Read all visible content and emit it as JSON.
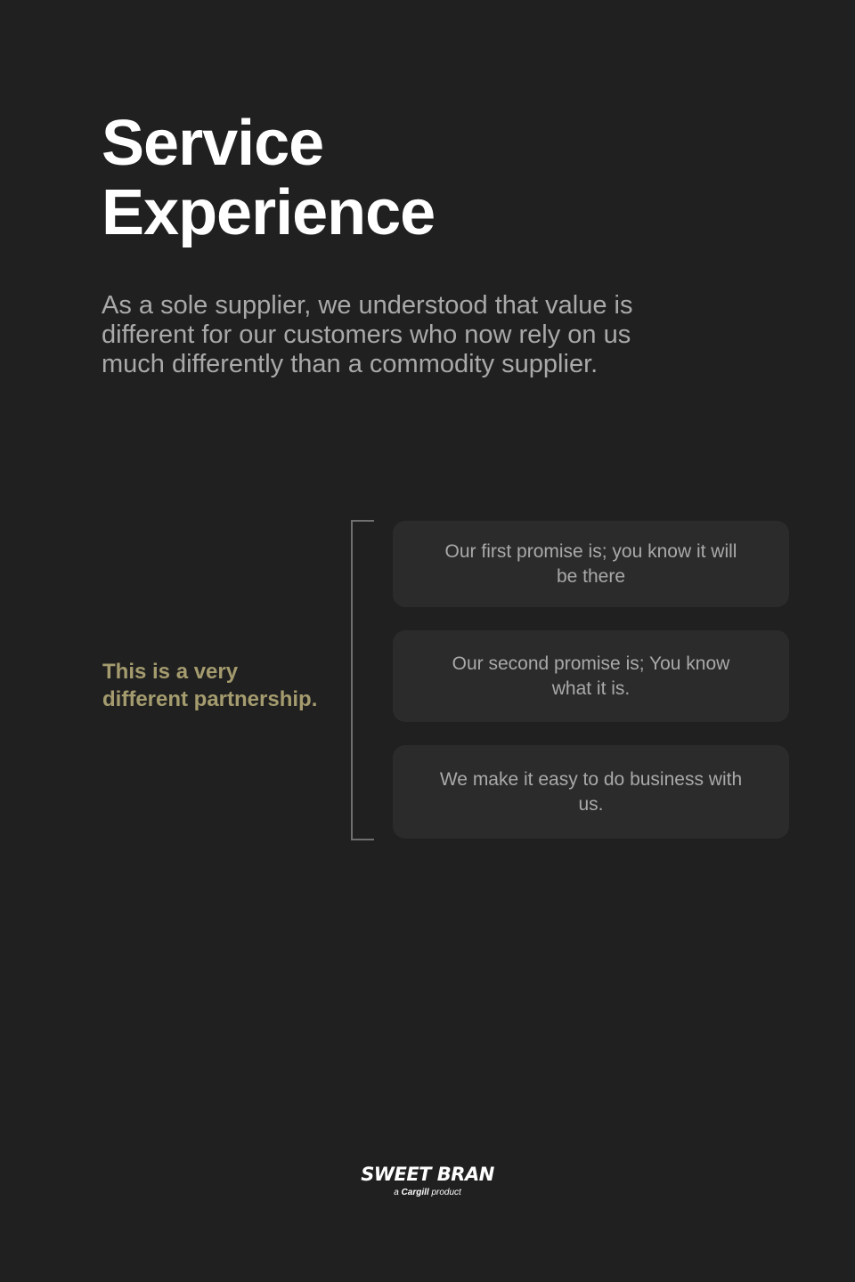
{
  "header": {
    "title_line1": "Service",
    "title_line2": "Experience"
  },
  "intro": {
    "line1": "As a sole supplier, we understood that value is",
    "line2": "different for our customers who now rely on us",
    "line3": "much differently than a commodity supplier."
  },
  "partnership": {
    "tagline_line1": "This is a very",
    "tagline_line2": "different partnership."
  },
  "promises": [
    {
      "text": "Our first promise is; you know it will be there"
    },
    {
      "text": "Our second promise is; You know what it is."
    },
    {
      "text": "We make it easy to do business with us."
    }
  ],
  "footer": {
    "logo_text": "SWEET BRAN",
    "tagline_prefix": "a",
    "tagline_brand": "Cargill",
    "tagline_suffix": "product"
  },
  "colors": {
    "background": "#202020",
    "title": "#ffffff",
    "body_text": "#a9a9a9",
    "accent": "#a49b6e",
    "card": "#2b2b2b",
    "bracket": "#6f6f6f"
  }
}
